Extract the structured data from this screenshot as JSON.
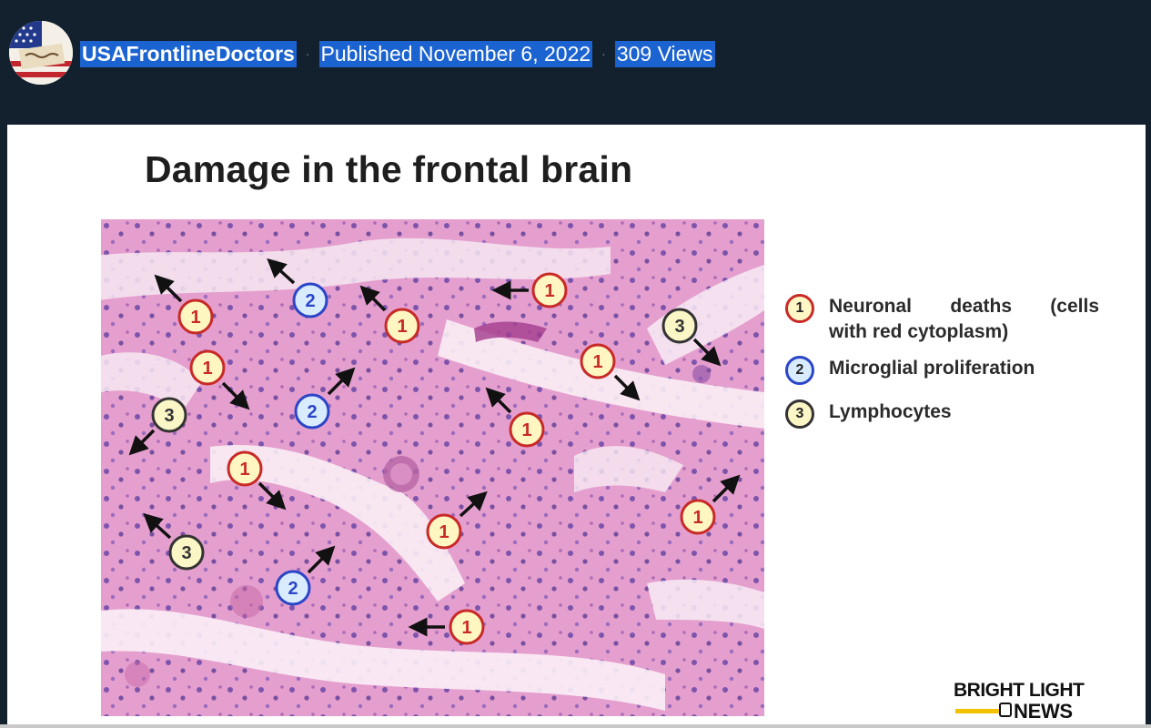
{
  "channel": {
    "name": "USAFrontlineDoctors",
    "avatar_icon": "we-the-people-flag-icon"
  },
  "published": "Published November 6, 2022",
  "views": "309 Views",
  "separator": "·",
  "slide": {
    "title": "Damage in the frontal brain",
    "legend": [
      {
        "num": "1",
        "label_line1": [
          "Neuronal",
          "deaths",
          "(cells"
        ],
        "label_line2": "with red cytoplasm)"
      },
      {
        "num": "2",
        "label": "Microglial proliferation"
      },
      {
        "num": "3",
        "label": "Lymphocytes"
      }
    ],
    "markers": [
      {
        "num": "1",
        "arrow": "up-left"
      },
      {
        "num": "2",
        "arrow": "up-left"
      },
      {
        "num": "1",
        "arrow": "up-left"
      },
      {
        "num": "1",
        "arrow": "left"
      },
      {
        "num": "3",
        "arrow": "down-right"
      },
      {
        "num": "1",
        "arrow": "down-right"
      },
      {
        "num": "2",
        "arrow": "up-right"
      },
      {
        "num": "1",
        "arrow": "down-right"
      },
      {
        "num": "3",
        "arrow": "down-left"
      },
      {
        "num": "1",
        "arrow": "up-left"
      },
      {
        "num": "1",
        "arrow": "down-right"
      },
      {
        "num": "1",
        "arrow": "up-right"
      },
      {
        "num": "1",
        "arrow": "up-right"
      },
      {
        "num": "3",
        "arrow": "up-left"
      },
      {
        "num": "2",
        "arrow": "up-right"
      },
      {
        "num": "1",
        "arrow": "left"
      }
    ]
  },
  "brand": {
    "line1": "BRIGHT LIGHT",
    "line2": "NEWS"
  },
  "colors": {
    "header_bg": "#13202e",
    "selection": "#1b63d0",
    "marker1": "#c82a27",
    "marker2": "#2b45c7",
    "marker3": "#333333",
    "tissue": "#e7a2d2"
  }
}
